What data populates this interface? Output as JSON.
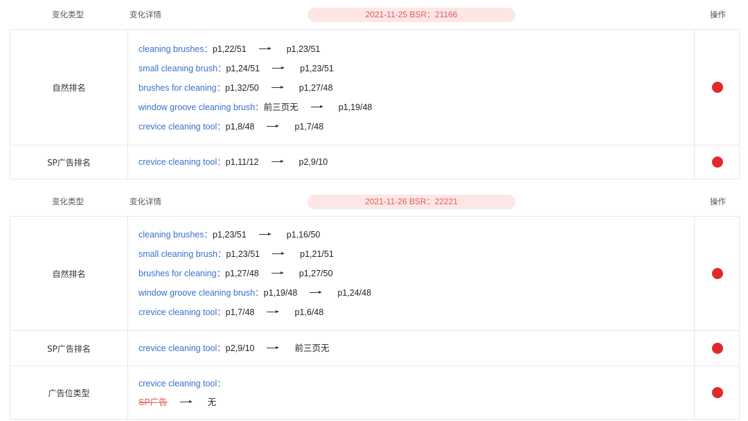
{
  "headers": {
    "type": "变化类型",
    "detail": "变化详情",
    "op": "操作"
  },
  "groups": [
    {
      "date": "2021-11-25   BSR：21166",
      "rows": [
        {
          "type": "自然排名",
          "lines": [
            {
              "kw": "cleaning brushes：",
              "from": "p1,22/51",
              "to": "p1,23/51"
            },
            {
              "kw": "small cleaning brush：",
              "from": "p1,24/51",
              "to": "p1,23/51"
            },
            {
              "kw": "brushes for cleaning：",
              "from": "p1,32/50",
              "to": "p1,27/48"
            },
            {
              "kw": "window groove cleaning brush：",
              "from": "前三页无",
              "to": "p1,19/48"
            },
            {
              "kw": "crevice cleaning tool：",
              "from": "p1,8/48",
              "to": "p1,7/48"
            }
          ]
        },
        {
          "type": "SP广告排名",
          "lines": [
            {
              "kw": "crevice cleaning tool：",
              "from": "p1,11/12",
              "to": "p2,9/10"
            }
          ]
        }
      ]
    },
    {
      "date": "2021-11-26   BSR：22221",
      "rows": [
        {
          "type": "自然排名",
          "lines": [
            {
              "kw": "cleaning brushes：",
              "from": "p1,23/51",
              "to": "p1,16/50"
            },
            {
              "kw": "small cleaning brush：",
              "from": "p1,23/51",
              "to": "p1,21/51"
            },
            {
              "kw": "brushes for cleaning：",
              "from": "p1,27/48",
              "to": "p1,27/50"
            },
            {
              "kw": "window groove cleaning brush：",
              "from": "p1,19/48",
              "to": "p1,24/48"
            },
            {
              "kw": "crevice cleaning tool：",
              "from": "p1,7/48",
              "to": "p1,6/48"
            }
          ]
        },
        {
          "type": "SP广告排名",
          "lines": [
            {
              "kw": "crevice cleaning tool：",
              "from": "p2,9/10",
              "to": "前三页无"
            }
          ]
        },
        {
          "type": "广告位类型",
          "kw_only": "crevice cleaning tool：",
          "from_struck": "SP广告",
          "to": "无"
        }
      ]
    }
  ],
  "colors": {
    "keyword": "#3a6fd0",
    "date_pill_bg": "#fde6e6",
    "date_pill_text": "#e05a5a",
    "dot": "#e02a2a"
  },
  "icons": {
    "arrow": "right-arrow-icon",
    "action": "red-dot-icon"
  }
}
